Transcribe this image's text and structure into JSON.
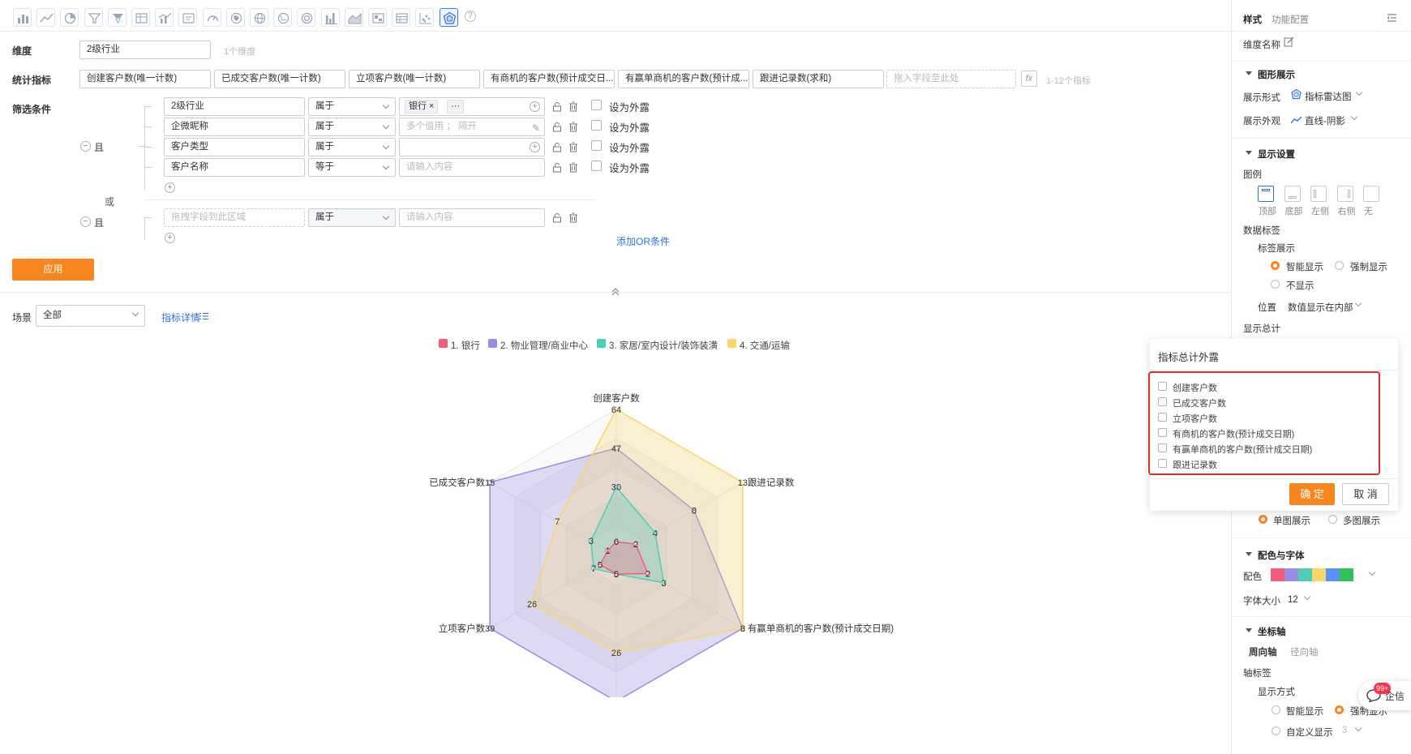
{
  "toolbar": {
    "icons": [
      "bar-chart-icon",
      "line-chart-icon",
      "pie-chart-icon",
      "funnel-icon",
      "funnel-alt-icon",
      "table-icon",
      "combo-chart-icon",
      "text-card-icon",
      "gauge-icon",
      "map-icon",
      "globe-icon",
      "world-map-icon",
      "ring-icon",
      "column-icon",
      "area-chart-icon",
      "image-icon",
      "pivot-table-icon",
      "scatter-icon",
      "radar-chart-icon"
    ],
    "active_index": 18,
    "help": "?"
  },
  "dimension": {
    "label": "维度",
    "value": "2级行业",
    "hint": "1个维度"
  },
  "metrics": {
    "label": "统计指标",
    "items": [
      "创建客户数(唯一计数)",
      "已成交客户数(唯一计数)",
      "立项客户数(唯一计数)",
      "有商机的客户数(预计成交日...",
      "有赢单商机的客户数(预计成...",
      "跟进记录数(求和)"
    ],
    "drop_placeholder": "拖入字段至此处",
    "fx": "fx",
    "hint": "1-12个指标"
  },
  "filters": {
    "label": "筛选条件",
    "and_label": "且",
    "or_label": "或",
    "group1": [
      {
        "field": "2级行业",
        "op": "属于",
        "tag": "银行",
        "more": "···",
        "value_placeholder": "",
        "expose": "设为外露"
      },
      {
        "field": "企微昵称",
        "op": "属于",
        "value_placeholder": "多个值用 ； 隔开",
        "expose": "设为外露"
      },
      {
        "field": "客户类型",
        "op": "属于",
        "value_placeholder": "",
        "expose": "设为外露"
      },
      {
        "field": "客户名称",
        "op": "等于",
        "value_placeholder": "请输入内容",
        "expose": "设为外露"
      }
    ],
    "group2": [
      {
        "field_placeholder": "拖拽字段到此区域",
        "op": "属于",
        "value_placeholder": "请输入内容"
      }
    ],
    "add_or": "添加OR条件",
    "apply": "应用"
  },
  "scene": {
    "label": "场景",
    "value": "全部",
    "detail_link": "指标详情"
  },
  "chart_data": {
    "type": "radar",
    "indicators": [
      "创建客户数",
      "跟进记录数",
      "有赢单商机的客户数(预计成交日期)",
      "有商机的客户数(预计成交日期)",
      "立项客户数",
      "已成交客户数"
    ],
    "max": [
      64,
      13,
      8,
      39,
      39,
      15
    ],
    "series": [
      {
        "name": "1. 银行",
        "color": "#f25c7a",
        "values": [
          6,
          2,
          2,
          5,
          5,
          1
        ]
      },
      {
        "name": "2. 物业管理/商业中心",
        "color": "#9b8ae6",
        "values": [
          47,
          8,
          8,
          39,
          39,
          15
        ]
      },
      {
        "name": "3. 家居/室内设计/装饰装潢",
        "color": "#4dcfb4",
        "values": [
          30,
          4,
          3,
          5,
          7,
          3
        ]
      },
      {
        "name": "4. 交通/运输",
        "color": "#f9d66a",
        "values": [
          64,
          13,
          8,
          26,
          26,
          7
        ]
      }
    ],
    "value_labels": [
      {
        "series": 0,
        "values": [
          "6",
          "2",
          "2",
          "5",
          "5",
          "1"
        ]
      },
      {
        "series": 1,
        "values": [
          "47",
          "8",
          "8",
          "39",
          "39",
          "15"
        ]
      },
      {
        "series": 2,
        "values": [
          "30",
          "4",
          "3",
          "5",
          "7",
          "3"
        ]
      },
      {
        "series": 3,
        "values": [
          "64",
          "13",
          "8",
          "26",
          "26",
          "7"
        ]
      }
    ],
    "legend_position": "top"
  },
  "right_panel": {
    "tabs": [
      "样式",
      "功能配置"
    ],
    "dimension_name_label": "维度名称",
    "graphic_section": "图形展示",
    "display_form_label": "展示形式",
    "display_form_value": "指标雷达图",
    "display_look_label": "展示外观",
    "display_look_value": "直线-阴影",
    "display_settings": "显示设置",
    "legend_label": "图例",
    "legend_options": [
      "顶部",
      "底部",
      "左侧",
      "右侧",
      "无"
    ],
    "data_label": "数据标签",
    "label_display": "标签展示",
    "label_options": [
      "智能显示",
      "强制显示",
      "不显示"
    ],
    "position_label": "位置",
    "position_value": "数值显示在内部",
    "show_total": "显示总计",
    "multi_options": [
      "单图展示",
      "多图展示"
    ],
    "color_font": "配色与字体",
    "palette_label": "配色",
    "palette": [
      "#f25c7a",
      "#9b8ae6",
      "#4dcfb4",
      "#f9d66a",
      "#5b8ff9",
      "#2fc25b"
    ],
    "font_size_label": "字体大小",
    "font_size_value": "12",
    "axis": "坐标轴",
    "axis_tabs": [
      "周向轴",
      "径向轴"
    ],
    "axis_label": "轴标签",
    "show_mode": "显示方式",
    "show_mode_options": [
      "智能显示",
      "强制显示",
      "自定义显示"
    ],
    "custom_value": "3",
    "chat_label": "企信",
    "chat_badge": "99+"
  },
  "popup": {
    "title": "指标总计外露",
    "items": [
      "创建客户数",
      "已成交客户数",
      "立项客户数",
      "有商机的客户数(预计成交日期)",
      "有赢单商机的客户数(预计成交日期)",
      "跟进记录数"
    ],
    "confirm": "确 定",
    "cancel": "取 消"
  }
}
